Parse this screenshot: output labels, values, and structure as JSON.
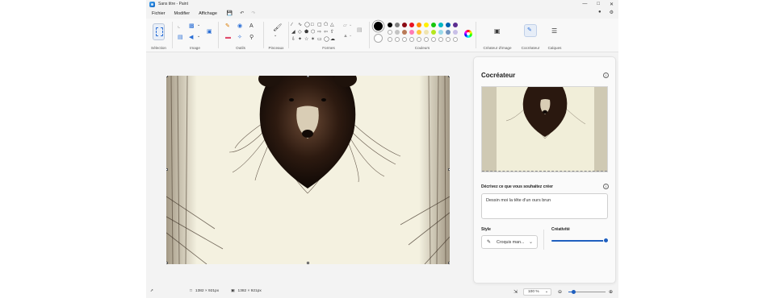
{
  "window": {
    "title": "Sans titre - Paint"
  },
  "menu": {
    "file": "Fichier",
    "edit": "Modifier",
    "view": "Affichage"
  },
  "ribbon": {
    "groups": {
      "selection": "Sélection",
      "image": "Image",
      "tools": "Outils",
      "brushes": "Pinceaux",
      "shapes": "Formes",
      "colors": "Couleurs",
      "image_creator": "Créateur d'image",
      "cocreator": "Cocréateur",
      "layers": "Calques"
    },
    "palette_row1": [
      "#000000",
      "#7f7f7f",
      "#8b0a14",
      "#e81123",
      "#ff8c00",
      "#fff100",
      "#16c60c",
      "#00b7c3",
      "#0063b1",
      "#5c2d91"
    ],
    "palette_row2": [
      "#ffffff",
      "#c3c3c3",
      "#b97a57",
      "#ff7ab6",
      "#ffc83d",
      "#efe4b0",
      "#b5e61d",
      "#99d9ea",
      "#7092be",
      "#c8bfe7"
    ]
  },
  "panel": {
    "title": "Cocréateur",
    "describe_label": "Décrivez ce que vous souhaitez créer",
    "prompt_text": "Dessin moi la tête d'un ours brun",
    "style_label": "Style",
    "style_value": "Croquis man...",
    "creativity_label": "Créativité",
    "creativity_level": 1.0
  },
  "status": {
    "selection_size": "1382 × 921px",
    "canvas_size": "1382 × 921px",
    "zoom": "100 %",
    "zoom_level_fraction": 0.15
  },
  "colors": {
    "accent": "#1f5fbf",
    "canvas": "#f4f1e0"
  }
}
